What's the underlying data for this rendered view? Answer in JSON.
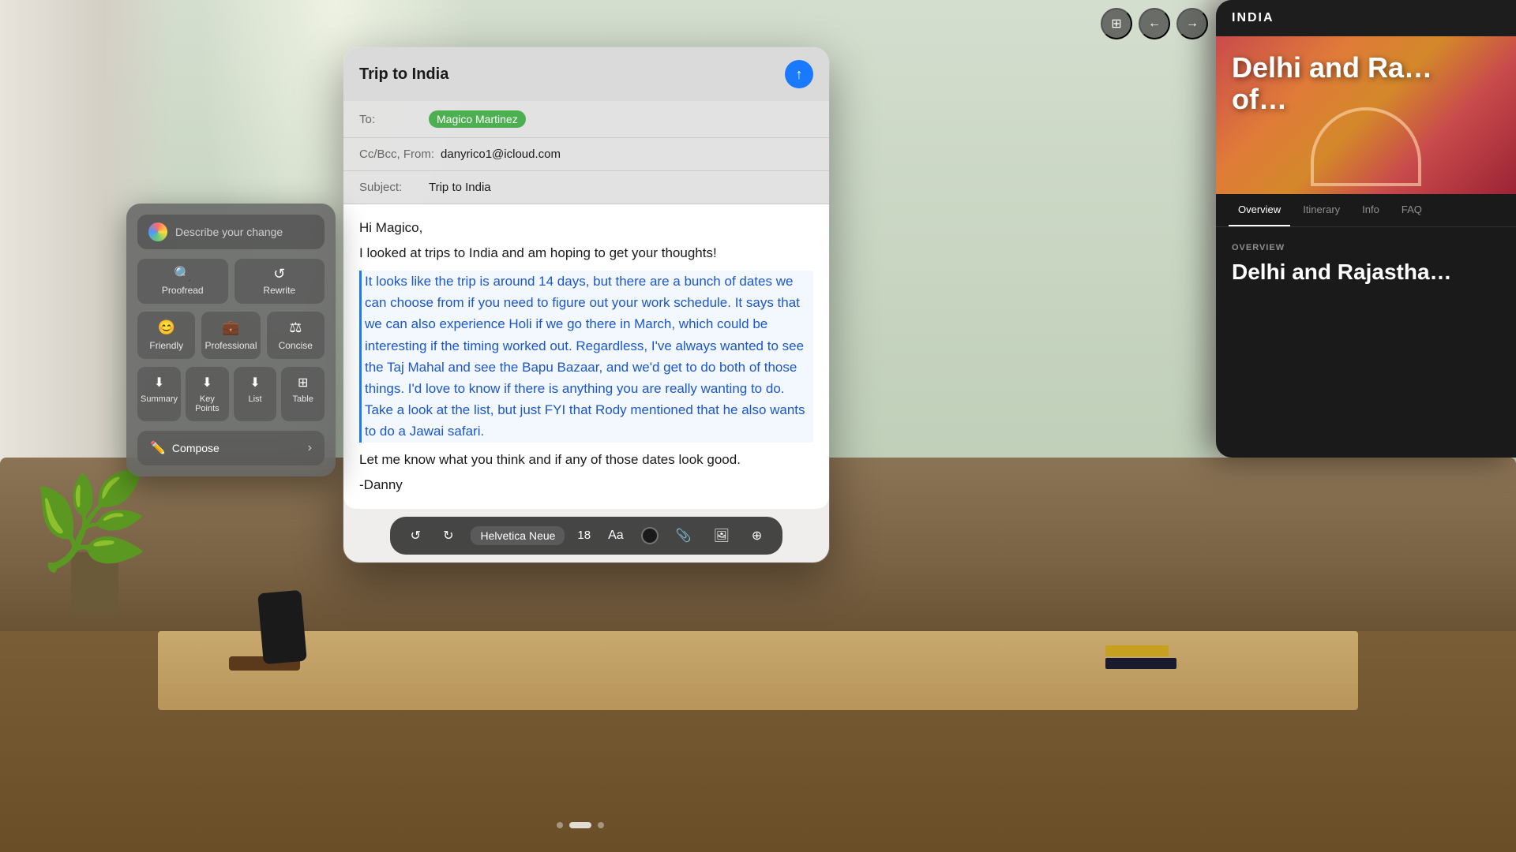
{
  "background": {
    "description": "Living room with couch, table, plants"
  },
  "topBar": {
    "windowIcon": "⊞",
    "backIcon": "←",
    "forwardIcon": "→"
  },
  "emailWindow": {
    "title": "Trip to India",
    "sendButtonLabel": "Send",
    "toLabel": "To:",
    "recipient": "Magico Martinez",
    "ccLabel": "Cc/Bcc, From:",
    "fromEmail": "danyrico1@icloud.com",
    "subjectLabel": "Subject:",
    "subject": "Trip to India",
    "greeting": "Hi Magico,",
    "firstLine": "I looked at trips to India and am hoping to get your thoughts!",
    "selectedText": "It looks like the trip is around 14 days, but there are a bunch of dates we can choose from if you need to figure out your work schedule. It says that we can also experience Holi if we go there in March, which could be interesting if the timing worked out. Regardless, I've always wanted to see the Taj Mahal and see the Bapu Bazaar, and we'd get to do both of those things.  I'd love to know if there is anything you are really wanting to do. Take a look at the list, but just FYI that Rody mentioned that he also wants to do a Jawai safari.",
    "closing": "Let me know what you think and if any of those dates look good.",
    "signature": "-Danny"
  },
  "toolbar": {
    "undoLabel": "↺",
    "redoLabel": "↻",
    "fontName": "Helvetica Neue",
    "fontSize": "18",
    "fontSizeIcon": "Aa",
    "colorIcon": "●",
    "attachIcon": "📎",
    "photoIcon": "🖼",
    "moreIcon": "⊕"
  },
  "aiPanel": {
    "describePlaceholder": "Describe your change",
    "describeIcon": "✦",
    "tools": [
      {
        "id": "proofread",
        "label": "Proofread",
        "icon": "🔍"
      },
      {
        "id": "rewrite",
        "label": "Rewrite",
        "icon": "↺"
      }
    ],
    "tones": [
      {
        "id": "friendly",
        "label": "Friendly",
        "icon": "😊"
      },
      {
        "id": "professional",
        "label": "Professional",
        "icon": "💼"
      },
      {
        "id": "concise",
        "label": "Concise",
        "icon": "⚖"
      }
    ],
    "formats": [
      {
        "id": "summary",
        "label": "Summary",
        "icon": "≡"
      },
      {
        "id": "key-points",
        "label": "Key Points",
        "icon": "≡"
      },
      {
        "id": "list",
        "label": "List",
        "icon": "≡"
      },
      {
        "id": "table",
        "label": "Table",
        "icon": "⊞"
      }
    ],
    "composeLabel": "Compose",
    "composeIcon": "✏️"
  },
  "indiaPanel": {
    "headerTitle": "INDIA",
    "heroTitle": "Delhi and Ra…\nof…",
    "navItems": [
      {
        "id": "overview",
        "label": "Overview",
        "active": true
      },
      {
        "id": "itinerary",
        "label": "Itinerary",
        "active": false
      },
      {
        "id": "info",
        "label": "Info",
        "active": false
      },
      {
        "id": "faq",
        "label": "FAQ",
        "active": false
      }
    ],
    "overviewLabel": "OVERVIEW",
    "overviewTitle": "Delhi and Rajastha…"
  },
  "pageDots": [
    {
      "active": false
    },
    {
      "active": true
    },
    {
      "active": false
    }
  ]
}
